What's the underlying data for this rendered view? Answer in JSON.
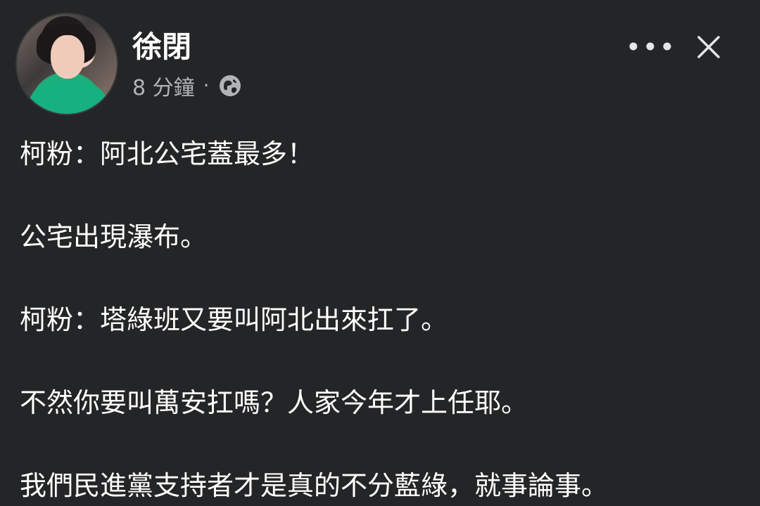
{
  "post": {
    "author": "徐閉",
    "timestamp": "8 分鐘",
    "separator": "·",
    "privacy_icon": "globe-icon",
    "more_icon": "more-horizontal-icon",
    "close_icon": "close-icon",
    "lines": [
      "柯粉：阿北公宅蓋最多！",
      "公宅出現瀑布。",
      "柯粉：塔綠班又要叫阿北出來扛了。",
      "不然你要叫萬安扛嗎？人家今年才上任耶。",
      "我們民進黨支持者才是真的不分藍綠，就事論事。"
    ]
  },
  "colors": {
    "background": "#242526",
    "text_primary": "#ffffff",
    "text_secondary": "#b0b3b8"
  }
}
